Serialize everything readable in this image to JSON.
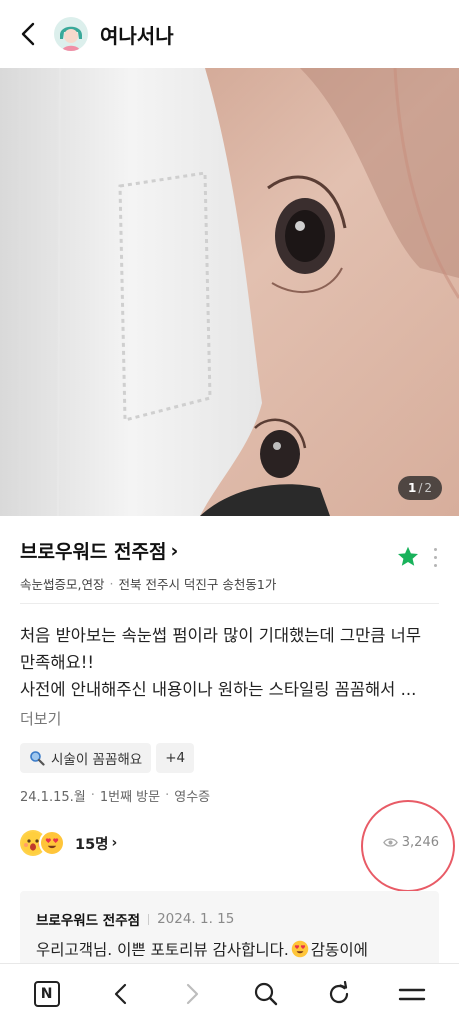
{
  "header": {
    "username": "여나서나"
  },
  "photo": {
    "counter_current": "1",
    "counter_separator": "/",
    "counter_total": "2"
  },
  "store": {
    "name": "브로우워드 전주점",
    "arrow": "›",
    "category": "속눈썹증모,연장",
    "location": "전북 전주시 덕진구 송천동1가",
    "favorite_color": "#19b25b"
  },
  "review": {
    "text": "처음 받아보는 속눈썹 펌이라 많이 기대했는데 그만큼 너무 만족해요!! 사전에 안내해주신 내용이나 원하는 스타일링 꼼꼼해서 ...",
    "line1": "처음 받아보는 속눈썹 펌이라 많이 기대했는데 그만큼 너무",
    "line2": "만족해요!!",
    "line3": "사전에 안내해주신 내용이나 원하는 스타일링 꼼꼼해서 ...",
    "more_label": "더보기"
  },
  "tags": {
    "first": "시술이 꼼꼼해요",
    "extra": "+4"
  },
  "visit": {
    "date": "24.1.15.월",
    "count": "1번째 방문",
    "proof": "영수증"
  },
  "reactions": {
    "count_label": "15명",
    "arrow": "›"
  },
  "views": {
    "count": "3,246",
    "highlight_color": "#e85b66"
  },
  "reply": {
    "name": "브로우워드 전주점",
    "date": "2024. 1. 15",
    "text_before": "우리고객님. 이쁜 포토리뷰 감사합니다.",
    "text_after": "감동이에"
  },
  "bottom_nav": {
    "n_label": "N",
    "items": [
      "n-logo-icon",
      "back-icon",
      "forward-icon",
      "search-icon",
      "refresh-icon",
      "menu-icon"
    ]
  }
}
